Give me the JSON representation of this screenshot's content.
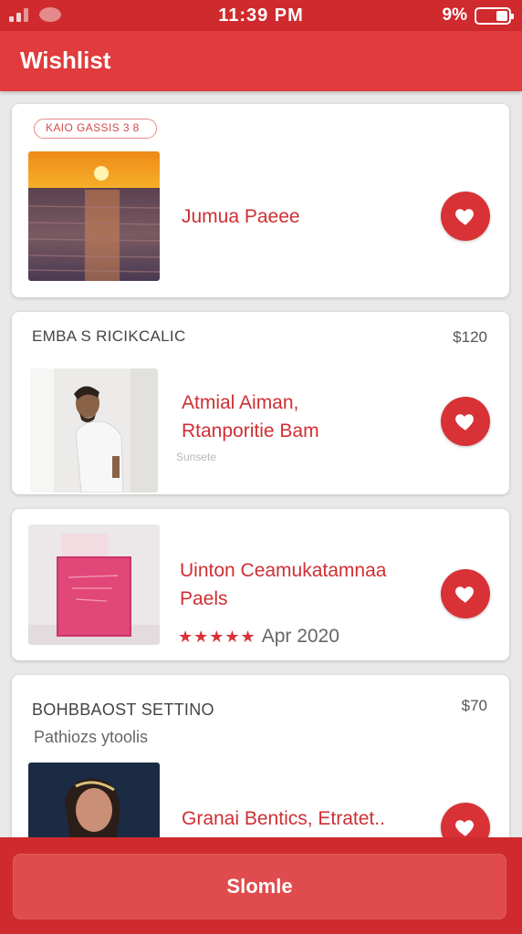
{
  "status_bar": {
    "time": "11:39 PM",
    "battery_percent": "9%",
    "battery_level": 0.3,
    "icons": [
      "signal-icon",
      "message-icon",
      "battery-icon"
    ]
  },
  "header": {
    "title": "Wishlist"
  },
  "items": [
    {
      "tag": "KAIO GASSIS 3 8",
      "title_lines": [
        "Jumua Paeee"
      ],
      "image": "sunset-sea-photo",
      "favorited": true
    },
    {
      "label": "EMBA S RICIKCALIC",
      "price": "$120",
      "title_lines": [
        "Atmial Aiman,",
        "Rtanporitie Bam"
      ],
      "sub_text": "Sunsete",
      "image": "man-white-shirt-photo",
      "favorited": true
    },
    {
      "title_lines": [
        "Uinton Ceamukatamnaa",
        "Paels"
      ],
      "rating": 4.5,
      "rating_stars": "★★★★★",
      "rating_date": "Apr 2020",
      "image": "pink-book-photo",
      "favorited": true
    },
    {
      "label": "BOHBBAOST SETTINO",
      "subtitle": "Pathiozs ytoolis",
      "price": "$70",
      "title_lines": [
        "Granai Bentics, Etratet.."
      ],
      "image": "woman-portrait-photo",
      "favorited": true
    }
  ],
  "bottom_button": {
    "label": "Slomle"
  },
  "colors": {
    "primary": "#e03b3d",
    "primary_dark": "#cf2a2d",
    "accent_text": "#cf2f33",
    "background": "#e9e9e9"
  }
}
